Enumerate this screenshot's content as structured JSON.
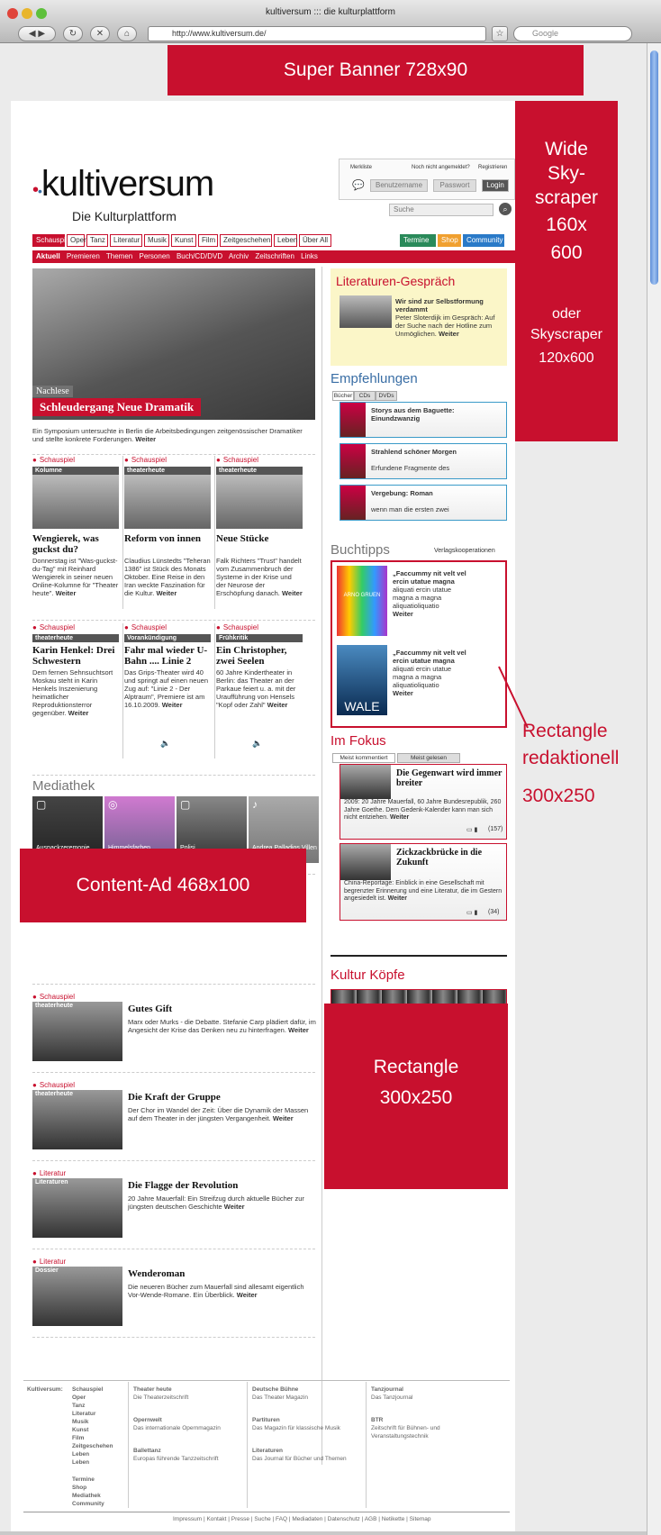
{
  "browser": {
    "title": "kultiversum ::: die kulturplattform",
    "url": "http://www.kultiversum.de/",
    "search_placeholder": "Google"
  },
  "ads": {
    "super_banner": "Super Banner 728x90",
    "skyscraper_l1": "Wide",
    "skyscraper_l2": "Sky-",
    "skyscraper_l3": "scraper",
    "skyscraper_l4": "160x",
    "skyscraper_l5": "600",
    "skyscraper_l6": "oder",
    "skyscraper_l7": "Skyscraper",
    "skyscraper_l8": "120x600",
    "content_ad": "Content-Ad 468x100",
    "rect_l1": "Rectangle",
    "rect_l2": "300x250"
  },
  "annotation": {
    "l1": "Rectangle",
    "l2": "redaktionell",
    "l3": "300x250"
  },
  "header": {
    "logo": "kultiversum",
    "tagline": "Die Kulturplattform",
    "merkliste": "Merkliste",
    "not_logged": "Noch nicht angemeldet?",
    "register": "Registrieren",
    "username": "Benutzername",
    "password": "Passwort",
    "login": "Login",
    "search_placeholder": "Suche"
  },
  "nav": {
    "tabs": [
      "Schauspiel",
      "Oper",
      "Tanz",
      "Literatur",
      "Musik",
      "Kunst",
      "Film",
      "Zeitgeschehen",
      "Leben",
      "Über All"
    ],
    "right": [
      "Termine",
      "Shop",
      "Community"
    ],
    "sub": [
      "Aktuell",
      "Premieren",
      "Themen",
      "Personen",
      "Buch/CD/DVD",
      "Archiv",
      "Zeitschriften",
      "Links"
    ]
  },
  "hero": {
    "overlay": "Nachlese",
    "title": "Schleudergang Neue Dramatik",
    "text": "Ein Symposium untersuchte in Berlin die Arbeitsbedingungen zeitgenössischer Dramatiker und stellte konkrete Forderungen.",
    "more": "Weiter"
  },
  "grid1": [
    {
      "kicker": "Schauspiel",
      "bar": "Kolumne",
      "title": "Wengierek, was guckst du?",
      "text": "Donnerstag ist \"Was-guckst-du-Tag\" mit Reinhard Wengierek in seiner neuen Online-Kolumne für \"Theater heute\".",
      "more": "Weiter"
    },
    {
      "kicker": "Schauspiel",
      "bar": "theaterheute",
      "title": "Reform von innen",
      "text": "Claudius Lünstedts \"Teheran 1386\" ist Stück des Monats Oktober. Eine Reise in den Iran weckte Faszination für die Kultur.",
      "more": "Weiter"
    },
    {
      "kicker": "Schauspiel",
      "bar": "theaterheute",
      "title": "Neue Stücke",
      "text": "Falk Richters \"Trust\" handelt vom Zusammenbruch der Systeme in der Krise und der Neurose der Erschöpfung danach.",
      "more": "Weiter"
    }
  ],
  "grid2": [
    {
      "kicker": "Schauspiel",
      "bar": "theaterheute",
      "title": "Karin Henkel: Drei Schwestern",
      "text": "Dem fernen Sehnsuchtsort Moskau steht in Karin Henkels Inszenierung heimatlicher Reproduktionsterror gegenüber.",
      "more": "Weiter"
    },
    {
      "kicker": "Schauspiel",
      "bar": "Vorankündigung",
      "title": "Fahr mal wieder U-Bahn .... Linie 2",
      "text": "Das Grips-Theater wird 40 und springt auf einen neuen Zug auf: \"Linie 2 - Der Alptraum\", Premiere ist am 16.10.2009.",
      "more": "Weiter"
    },
    {
      "kicker": "Schauspiel",
      "bar": "Frühkritik",
      "title": "Ein Christopher, zwei Seelen",
      "text": "60 Jahre Kindertheater in Berlin: das Theater an der Parkaue feiert u. a. mit der Uraufführung von Hensels \"Kopf oder Zahl\"",
      "more": "Weiter"
    }
  ],
  "mediathek": {
    "title": "Mediathek",
    "items": [
      "Auspackzeremonie",
      "Himmelsfarben",
      "Polisi",
      "Andrea Palladios Villen"
    ]
  },
  "list": [
    {
      "kicker": "Schauspiel",
      "bar": "theaterheute",
      "title": "Gutes Gift",
      "text": "Marx oder Murks - die Debatte. Stefanie Carp plädiert dafür, im Angesicht der Krise das Denken neu zu hinterfragen.",
      "more": "Weiter"
    },
    {
      "kicker": "Schauspiel",
      "bar": "theaterheute",
      "title": "Die Kraft der Gruppe",
      "text": "Der Chor im Wandel der Zeit: Über die Dynamik der Massen auf dem Theater in der jüngsten Vergangenheit.",
      "more": "Weiter"
    },
    {
      "kicker": "Literatur",
      "bar": "Literaturen",
      "title": "Die Flagge der Revolution",
      "text": "20 Jahre Mauerfall: Ein Streifzug durch aktuelle Bücher zur jüngsten deutschen Geschichte",
      "more": "Weiter"
    },
    {
      "kicker": "Literatur",
      "bar": "Dossier",
      "title": "Wenderoman",
      "text": "Die neueren Bücher zum Mauerfall sind allesamt eigentlich Vor-Wende-Romane. Ein Überblick.",
      "more": "Weiter"
    }
  ],
  "litgespraech": {
    "title": "Literaturen-Gespräch",
    "bold": "Wir sind zur Selbstformung verdammt",
    "text": "Peter Sloterdijk im Gespräch: Auf der Suche nach der Hotline zum Unmöglichen.",
    "more": "Weiter"
  },
  "empf": {
    "title": "Empfehlungen",
    "tabs": [
      "Bücher",
      "CDs",
      "DVDs"
    ],
    "items": [
      {
        "t": "Storys aus dem Baguette: Einundzwanzig",
        "s": ""
      },
      {
        "t": "Strahlend schöner Morgen",
        "s": "Erfundene Fragmente des"
      },
      {
        "t": "Vergebung: Roman",
        "s": "wenn man die ersten zwei"
      }
    ]
  },
  "buchtipps": {
    "title": "Buchtipps",
    "link": "Verlagskooperationen",
    "items": [
      {
        "cover": "ARNO GRUEN",
        "q": "„Faccummy nit velt vel ercin utatue magna",
        "t": "aliquati ercin utatue magna a magna aliquatioliquatio",
        "more": "Weiter"
      },
      {
        "cover": "WALE",
        "q": "„Faccummy nit velt vel ercin utatue magna",
        "t": "aliquati ercin utatue magna a magna aliquatioliquatio",
        "more": "Weiter"
      }
    ]
  },
  "fokus": {
    "title": "Im Fokus",
    "tabs": [
      "Meist kommentiert",
      "Meist gelesen"
    ],
    "items": [
      {
        "t": "Die Gegenwart wird immer breiter",
        "x": "2009: 20 Jahre Mauerfall, 60 Jahre Bundesrepublik, 260 Jahre Goethe. Dem Gedenk-Kalender kann man sich nicht entziehen.",
        "more": "Weiter",
        "n": "(157)"
      },
      {
        "t": "Zickzackbrücke in die Zukunft",
        "x": "China-Reportage: Einblick in eine Gesellschaft mit begrenzter Erinnerung und eine Literatur, die im Gestern angesiedelt ist.",
        "more": "Weiter",
        "n": "(34)"
      }
    ]
  },
  "koepfe": {
    "title": "Kultur Köpfe"
  },
  "footer": {
    "label": "Kultiversum:",
    "links": [
      "Schauspiel",
      "Oper",
      "Tanz",
      "Literatur",
      "Musik",
      "Kunst",
      "Film",
      "Zeitgeschehen",
      "Leben",
      "Leben"
    ],
    "links2": [
      "Termine",
      "Shop",
      "Mediathek",
      "Community"
    ],
    "c1": [
      {
        "h": "Theater heute",
        "d": "Die Theaterzeitschrift"
      },
      {
        "h": "Opernwelt",
        "d": "Das internationale Opernmagazin"
      },
      {
        "h": "Ballettanz",
        "d": "Europas führende Tanzzeitschrift"
      }
    ],
    "c2": [
      {
        "h": "Deutsche Bühne",
        "d": "Das Theater Magazin"
      },
      {
        "h": "Partituren",
        "d": "Das Magazin für klassische Musik"
      },
      {
        "h": "Literaturen",
        "d": "Das Journal für Bücher und Themen"
      }
    ],
    "c3": [
      {
        "h": "Tanzjournal",
        "d": "Das Tanzjournal"
      },
      {
        "h": "BTR",
        "d": "Zeitschrift für Bühnen- und Veranstaltungstechnik"
      }
    ],
    "bottom": "Impressum | Kontakt | Presse | Suche | FAQ | Mediadaten | Datenschutz | AGB | Netikette | Sitemap"
  },
  "colors": {
    "brand": "#c8102e",
    "link": "#3a6ea5",
    "termine": "#2a8a5a",
    "shop": "#f0a030",
    "community": "#2a7ac8"
  }
}
